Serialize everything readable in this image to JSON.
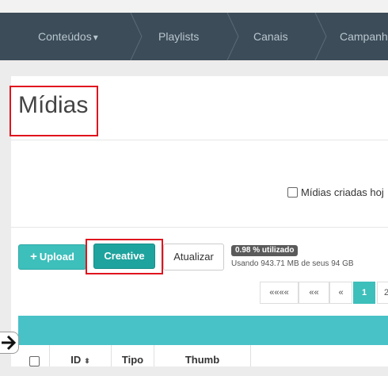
{
  "nav": {
    "items": [
      {
        "label": "Conteúdos",
        "caret": "▾"
      },
      {
        "label": "Playlists"
      },
      {
        "label": "Canais"
      },
      {
        "label": "Campanh"
      }
    ]
  },
  "page": {
    "title": "Mídias"
  },
  "filter": {
    "label": "Mídias criadas hoj"
  },
  "toolbar": {
    "upload_label": "Upload",
    "upload_icon": "+",
    "creative_label": "Creative",
    "refresh_label": "Atualizar"
  },
  "storage": {
    "badge": "0.98 % utilizado",
    "text": "Usando 943.71 MB de seus 94 GB"
  },
  "pagination": {
    "first": "««««",
    "prev_many": "««",
    "prev": "«",
    "current": "1",
    "next": "2"
  },
  "table": {
    "columns": [
      "ID",
      "Tipo",
      "Thumb"
    ],
    "sort_icon": "⬍"
  },
  "colors": {
    "nav_bg": "#3c4c58",
    "accent": "#3dbfbb",
    "creative": "#1fa39e",
    "highlight": "#e0141e",
    "table_header": "#48c2c7"
  }
}
